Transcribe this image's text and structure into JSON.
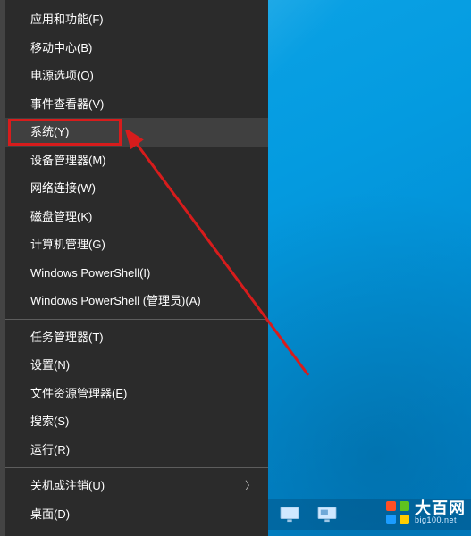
{
  "menu": {
    "groups": [
      [
        {
          "label": "应用和功能(F)"
        },
        {
          "label": "移动中心(B)"
        },
        {
          "label": "电源选项(O)"
        },
        {
          "label": "事件查看器(V)"
        },
        {
          "label": "系统(Y)",
          "highlighted": true
        },
        {
          "label": "设备管理器(M)"
        },
        {
          "label": "网络连接(W)"
        },
        {
          "label": "磁盘管理(K)"
        },
        {
          "label": "计算机管理(G)"
        },
        {
          "label": "Windows PowerShell(I)"
        },
        {
          "label": "Windows PowerShell (管理员)(A)"
        }
      ],
      [
        {
          "label": "任务管理器(T)"
        },
        {
          "label": "设置(N)"
        },
        {
          "label": "文件资源管理器(E)"
        },
        {
          "label": "搜索(S)"
        },
        {
          "label": "运行(R)"
        }
      ],
      [
        {
          "label": "关机或注销(U)",
          "submenu": true
        },
        {
          "label": "桌面(D)"
        }
      ]
    ]
  },
  "annotation": {
    "highlight_target": "系统(Y)"
  },
  "watermark": {
    "brand": "大百网",
    "url": "big100.net"
  }
}
